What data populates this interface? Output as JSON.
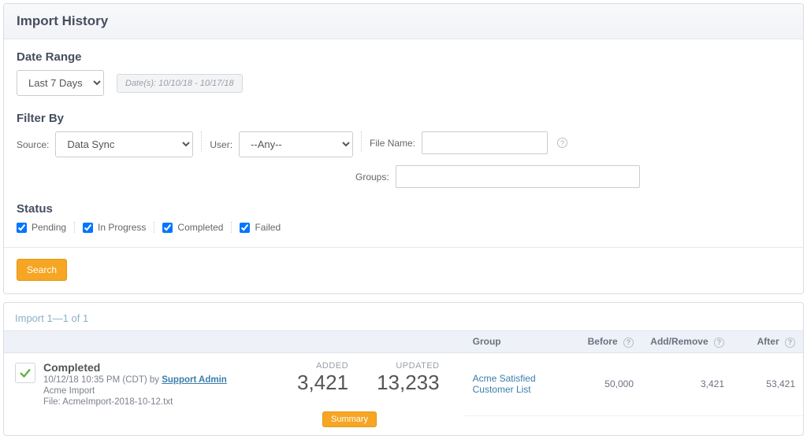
{
  "header": {
    "title": "Import History"
  },
  "dateRange": {
    "label": "Date Range",
    "selected": "Last 7 Days",
    "dates_chip": "Date(s): 10/10/18 - 10/17/18"
  },
  "filterBy": {
    "label": "Filter By",
    "source_label": "Source:",
    "source_value": "Data Sync",
    "user_label": "User:",
    "user_value": "--Any--",
    "filename_label": "File Name:",
    "filename_value": "",
    "groups_label": "Groups:",
    "groups_value": ""
  },
  "status": {
    "label": "Status",
    "pending": "Pending",
    "in_progress": "In Progress",
    "completed": "Completed",
    "failed": "Failed"
  },
  "search_button": "Search",
  "results": {
    "title": "Import 1—1 of 1",
    "columns": {
      "group": "Group",
      "before": "Before",
      "addremove": "Add/Remove",
      "after": "After"
    },
    "item": {
      "status": "Completed",
      "timestamp": "10/12/18 10:35 PM (CDT) ",
      "by_word": "by ",
      "author": "Support Admin",
      "name": "Acme Import",
      "file_line": "File: AcmeImport-2018-10-12.txt",
      "added_label": "ADDED",
      "added_value": "3,421",
      "updated_label": "UPDATED",
      "updated_value": "13,233",
      "summary_button": "Summary",
      "group_row": {
        "group": "Acme Satisfied Customer List",
        "before": "50,000",
        "addremove": "3,421",
        "after": "53,421"
      }
    }
  },
  "icons": {
    "help": "?"
  }
}
